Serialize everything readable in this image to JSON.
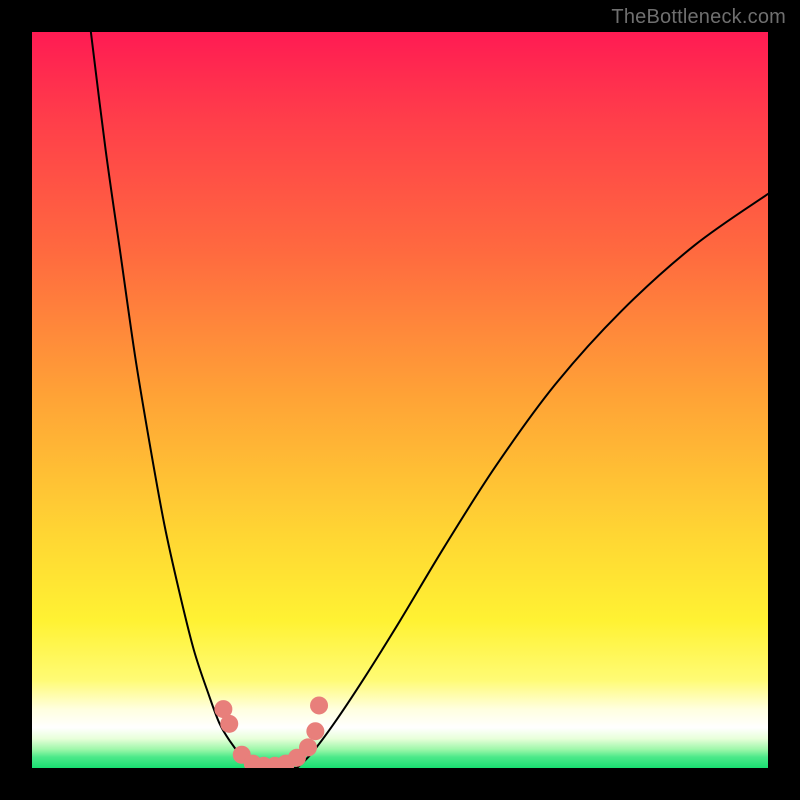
{
  "watermark": "TheBottleneck.com",
  "chart_data": {
    "type": "line",
    "title": "",
    "xlabel": "",
    "ylabel": "",
    "xlim": [
      0,
      100
    ],
    "ylim": [
      0,
      100
    ],
    "series": [
      {
        "name": "left-curve",
        "x": [
          8,
          10,
          12,
          14,
          16,
          18,
          20,
          22,
          24,
          25.5,
          27,
          28.5,
          30
        ],
        "y": [
          100,
          84,
          70,
          56,
          44,
          33,
          24,
          16,
          10,
          6,
          3.5,
          1.5,
          0
        ]
      },
      {
        "name": "right-curve",
        "x": [
          36,
          38,
          41,
          45,
          50,
          56,
          63,
          71,
          80,
          90,
          100
        ],
        "y": [
          0,
          2,
          6,
          12,
          20,
          30,
          41,
          52,
          62,
          71,
          78
        ]
      },
      {
        "name": "valley-floor",
        "x": [
          30,
          31.5,
          33,
          34.5,
          36
        ],
        "y": [
          0,
          0,
          0,
          0,
          0
        ]
      }
    ],
    "markers": [
      {
        "name": "highlight-dots",
        "color": "#e87f7b",
        "points": [
          {
            "x": 26.0,
            "y": 8.0
          },
          {
            "x": 26.8,
            "y": 6.0
          },
          {
            "x": 28.5,
            "y": 1.8
          },
          {
            "x": 30.0,
            "y": 0.6
          },
          {
            "x": 31.5,
            "y": 0.3
          },
          {
            "x": 33.0,
            "y": 0.3
          },
          {
            "x": 34.5,
            "y": 0.6
          },
          {
            "x": 36.0,
            "y": 1.4
          },
          {
            "x": 37.5,
            "y": 2.8
          },
          {
            "x": 38.5,
            "y": 5.0
          },
          {
            "x": 39.0,
            "y": 8.5
          }
        ]
      }
    ],
    "background": {
      "type": "vertical-gradient",
      "stops": [
        {
          "pos": 0,
          "color": "#ff1b53"
        },
        {
          "pos": 0.3,
          "color": "#ff6a3f"
        },
        {
          "pos": 0.68,
          "color": "#ffd533"
        },
        {
          "pos": 0.92,
          "color": "#ffffdf"
        },
        {
          "pos": 1.0,
          "color": "#19df71"
        }
      ]
    }
  }
}
